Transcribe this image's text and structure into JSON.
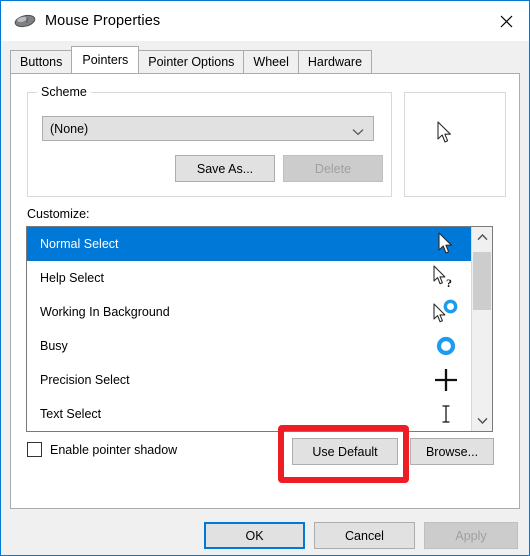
{
  "window": {
    "title": "Mouse Properties",
    "icon": "mouse-icon",
    "close_label": "close-icon",
    "accent_color": "#0078d7",
    "selection_color": "#0078d7",
    "annotation_color": "#ee1c25"
  },
  "tabs": [
    {
      "label": "Buttons",
      "active": false
    },
    {
      "label": "Pointers",
      "active": true
    },
    {
      "label": "Pointer Options",
      "active": false
    },
    {
      "label": "Wheel",
      "active": false
    },
    {
      "label": "Hardware",
      "active": false
    }
  ],
  "scheme": {
    "legend": "Scheme",
    "selected_value": "(None)",
    "save_as_label": "Save As...",
    "delete_label": "Delete",
    "delete_enabled": false
  },
  "preview": {
    "cursor": "arrow-cursor"
  },
  "customize": {
    "label": "Customize:",
    "items": [
      {
        "label": "Normal Select",
        "cursor": "arrow-cursor",
        "selected": true
      },
      {
        "label": "Help Select",
        "cursor": "arrow-help-cursor",
        "selected": false
      },
      {
        "label": "Working In Background",
        "cursor": "arrow-busy-cursor",
        "selected": false
      },
      {
        "label": "Busy",
        "cursor": "busy-ring-cursor",
        "selected": false
      },
      {
        "label": "Precision Select",
        "cursor": "crosshair-cursor",
        "selected": false
      },
      {
        "label": "Text Select",
        "cursor": "ibeam-cursor",
        "selected": false
      }
    ],
    "scrollbar": {
      "up": "chevron-up-icon",
      "down": "chevron-down-icon",
      "thumb_position": "top"
    }
  },
  "options": {
    "pointer_shadow_label": "Enable pointer shadow",
    "pointer_shadow_checked": false,
    "use_default_label": "Use Default",
    "browse_label": "Browse..."
  },
  "footer": {
    "ok_label": "OK",
    "cancel_label": "Cancel",
    "apply_label": "Apply",
    "apply_enabled": false
  }
}
